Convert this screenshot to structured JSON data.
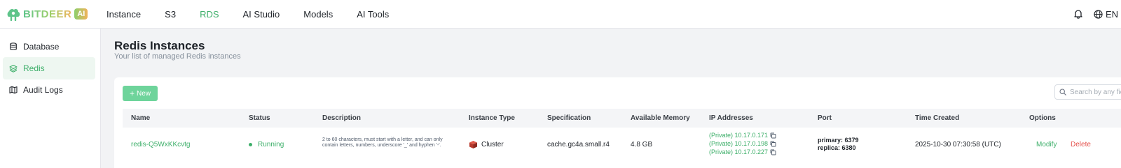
{
  "brand": {
    "name": "BITDEER",
    "badge": "AI"
  },
  "nav": {
    "items": [
      {
        "label": "Instance",
        "active": false
      },
      {
        "label": "S3",
        "active": false
      },
      {
        "label": "RDS",
        "active": true
      },
      {
        "label": "AI Studio",
        "active": false
      },
      {
        "label": "Models",
        "active": false
      },
      {
        "label": "AI Tools",
        "active": false
      }
    ]
  },
  "header_right": {
    "language": "EN",
    "notification_icon": "bell-icon",
    "language_icon": "globe-icon"
  },
  "sidebar": {
    "items": [
      {
        "label": "Database",
        "icon": "database-icon",
        "active": false
      },
      {
        "label": "Redis",
        "icon": "layers-icon",
        "active": true
      },
      {
        "label": "Audit Logs",
        "icon": "map-icon",
        "active": false
      }
    ]
  },
  "page": {
    "title": "Redis Instances",
    "subtitle": "Your list of managed Redis instances"
  },
  "toolbar": {
    "new_label": "New",
    "search_placeholder": "Search by any field"
  },
  "table": {
    "columns": [
      "Name",
      "Status",
      "Description",
      "Instance Type",
      "Specification",
      "Available Memory",
      "IP Addresses",
      "Port",
      "Time Created",
      "Options"
    ],
    "rows": [
      {
        "name": "redis-Q5WxKKcvtg",
        "status": "Running",
        "description": "2 to 60 characters, must start with a letter, and can only contain letters, numbers, underscore '_' and hyphen '-'.",
        "instance_type": "Cluster",
        "specification": "cache.gc4a.small.r4",
        "available_memory": "4.8 GB",
        "ip_addresses": [
          "(Private) 10.17.0.171",
          "(Private) 10.17.0.198",
          "(Private) 10.17.0.227"
        ],
        "port_primary": "primary: 6379",
        "port_replica": "replica: 6380",
        "time_created": "2025-10-30 07:30:58 (UTC)",
        "options": {
          "modify": "Modify",
          "delete": "Delete"
        }
      }
    ]
  },
  "colors": {
    "accent": "#3eaf6a",
    "new_button": "#6ed49b",
    "danger": "#e4504b",
    "background": "#f2f3f5"
  }
}
